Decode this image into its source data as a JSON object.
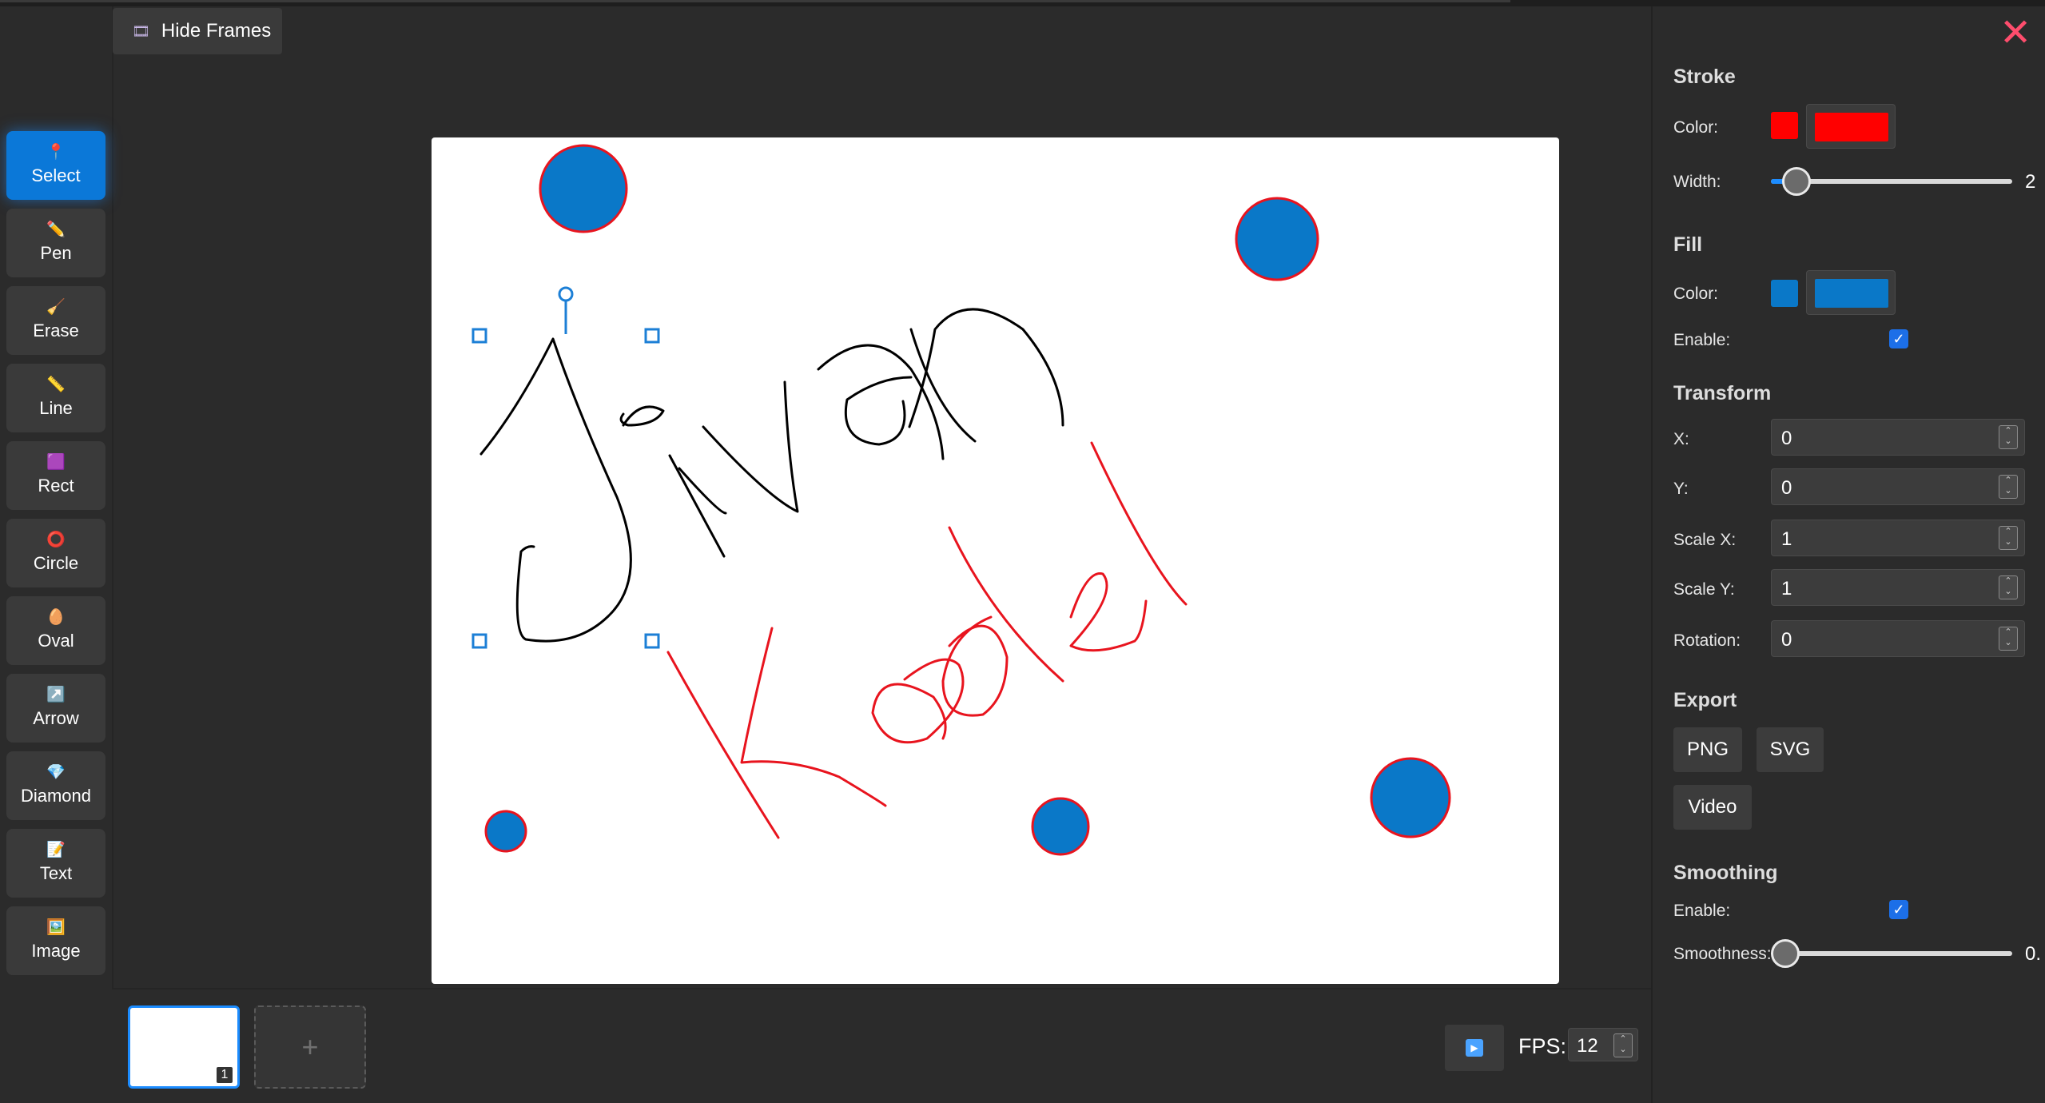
{
  "toolbar": {
    "hide_frames_label": "Hide Frames",
    "tools": [
      {
        "label": "Select",
        "icon": "pin-icon",
        "glyph": "📍"
      },
      {
        "label": "Pen",
        "icon": "pencil-icon",
        "glyph": "✏️"
      },
      {
        "label": "Erase",
        "icon": "broom-icon",
        "glyph": "🧹"
      },
      {
        "label": "Line",
        "icon": "line-icon",
        "glyph": "📏"
      },
      {
        "label": "Rect",
        "icon": "square-icon",
        "glyph": "🟪"
      },
      {
        "label": "Circle",
        "icon": "circle-icon",
        "glyph": "⭕"
      },
      {
        "label": "Oval",
        "icon": "egg-icon",
        "glyph": "🥚"
      },
      {
        "label": "Arrow",
        "icon": "arrow-icon",
        "glyph": "↗️"
      },
      {
        "label": "Diamond",
        "icon": "diamond-icon",
        "glyph": "💎"
      },
      {
        "label": "Text",
        "icon": "text-icon",
        "glyph": "📝"
      },
      {
        "label": "Image",
        "icon": "image-icon",
        "glyph": "🖼️"
      }
    ],
    "active_tool": "Select"
  },
  "frames": {
    "current_frame_number": "1",
    "add_label": "+",
    "fps_label": "FPS:",
    "fps_value": "12"
  },
  "panel": {
    "stroke": {
      "title": "Stroke",
      "color_label": "Color:",
      "color": "#ff0000",
      "width_label": "Width:",
      "width_value": "2"
    },
    "fill": {
      "title": "Fill",
      "color_label": "Color:",
      "color": "#0a78c8",
      "enable_label": "Enable:",
      "enabled": true
    },
    "transform": {
      "title": "Transform",
      "x_label": "X:",
      "x_value": "0",
      "y_label": "Y:",
      "y_value": "0",
      "scalex_label": "Scale X:",
      "scalex_value": "1",
      "scaley_label": "Scale Y:",
      "scaley_value": "1",
      "rotation_label": "Rotation:",
      "rotation_value": "0"
    },
    "export": {
      "title": "Export",
      "png_label": "PNG",
      "svg_label": "SVG",
      "video_label": "Video"
    },
    "smoothing": {
      "title": "Smoothing",
      "enable_label": "Enable:",
      "enabled": true,
      "smoothness_label": "Smoothness:",
      "smoothness_value": "0."
    }
  },
  "canvas": {
    "fill_color": "#0a78c8",
    "stroke_color": "#e8141e",
    "ink_color": "#000000"
  }
}
